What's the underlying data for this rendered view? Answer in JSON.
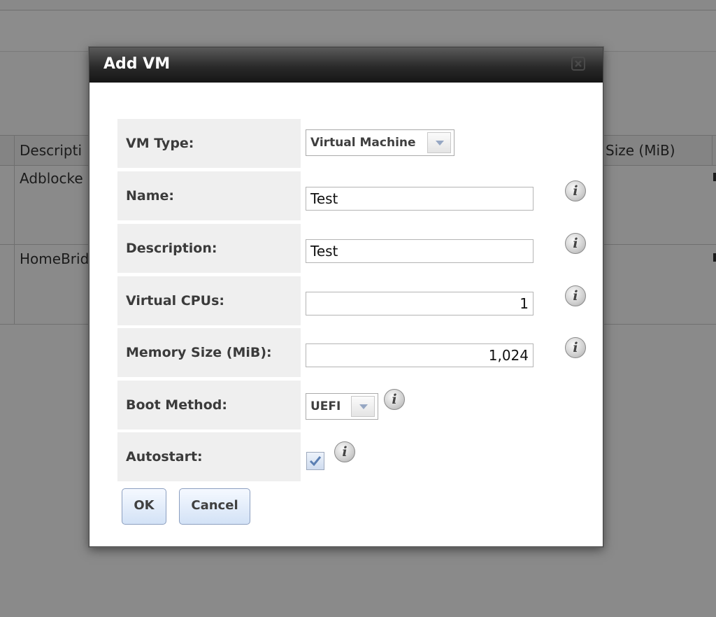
{
  "background": {
    "table_headers": [
      "Descripti",
      "Size (MiB)"
    ],
    "rows": [
      {
        "description": "Adblocke"
      },
      {
        "description": "HomeBrid"
      }
    ]
  },
  "dialog": {
    "title": "Add VM",
    "close_icon": "close-x-icon",
    "fields": {
      "vm_type": {
        "label": "VM Type:",
        "value": "Virtual Machine"
      },
      "name": {
        "label": "Name:",
        "value": "Test"
      },
      "description": {
        "label": "Description:",
        "value": "Test"
      },
      "vcpus": {
        "label": "Virtual CPUs:",
        "value": "1"
      },
      "memory": {
        "label": "Memory Size (MiB):",
        "value": "1,024"
      },
      "boot_method": {
        "label": "Boot Method:",
        "value": "UEFI"
      },
      "autostart": {
        "label": "Autostart:",
        "checked": true
      }
    },
    "info_glyph": "i",
    "buttons": {
      "ok": "OK",
      "cancel": "Cancel"
    }
  },
  "colors": {
    "overlay": "#8a8a8a",
    "header_dark": "#1e1e1e",
    "label_bg": "#efefef",
    "button_blue": "#d3e2f6"
  }
}
